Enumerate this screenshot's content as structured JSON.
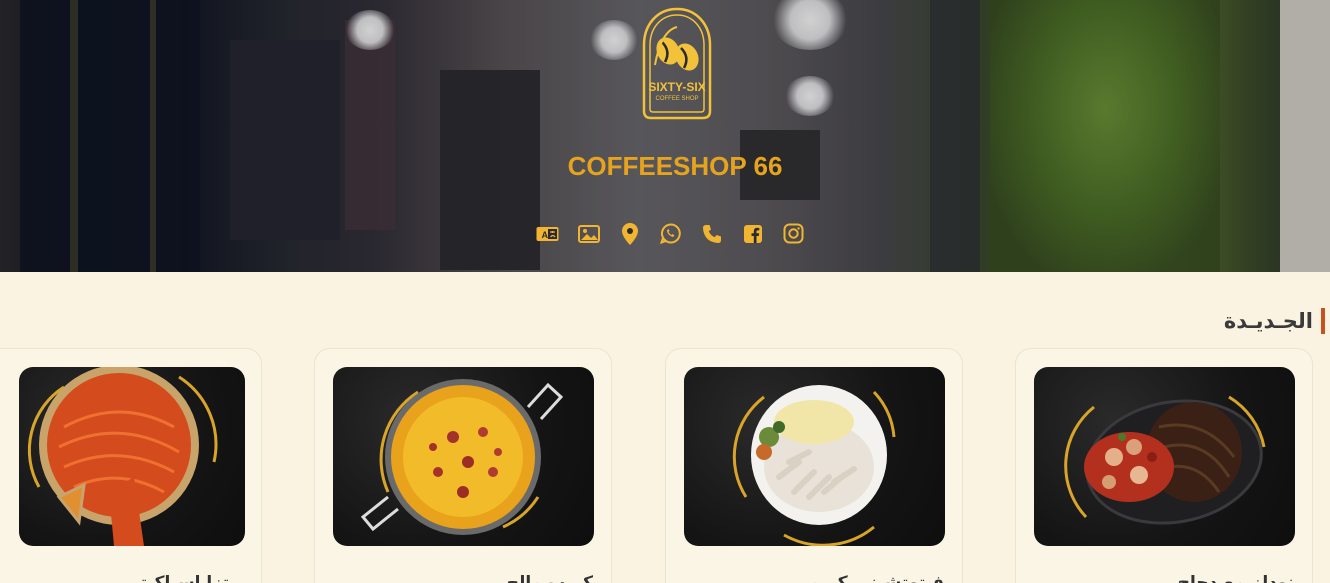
{
  "hero": {
    "brand_name": "COFFEESHOP 66",
    "logo_text": "SIXTY-SIX",
    "logo_subtext": "COFFEE SHOP",
    "icons": [
      "language-icon",
      "gallery-icon",
      "location-icon",
      "whatsapp-icon",
      "phone-icon",
      "facebook-icon",
      "instagram-icon"
    ]
  },
  "section": {
    "title": "الجـديـدة"
  },
  "items": [
    {
      "name": "نودلز مع دجاج",
      "dish": "noodles-chicken"
    },
    {
      "name": "فيتوتشيني كريمي",
      "dish": "penne-white-sauce"
    },
    {
      "name": "كريب مالح",
      "dish": "cheese-pan"
    },
    {
      "name": "بيتزا اسباكيتي",
      "dish": "spaghetti-pizza"
    }
  ],
  "colors": {
    "accent": "#e6a31e",
    "background": "#faf3e1",
    "section_bar": "#c8521f"
  }
}
